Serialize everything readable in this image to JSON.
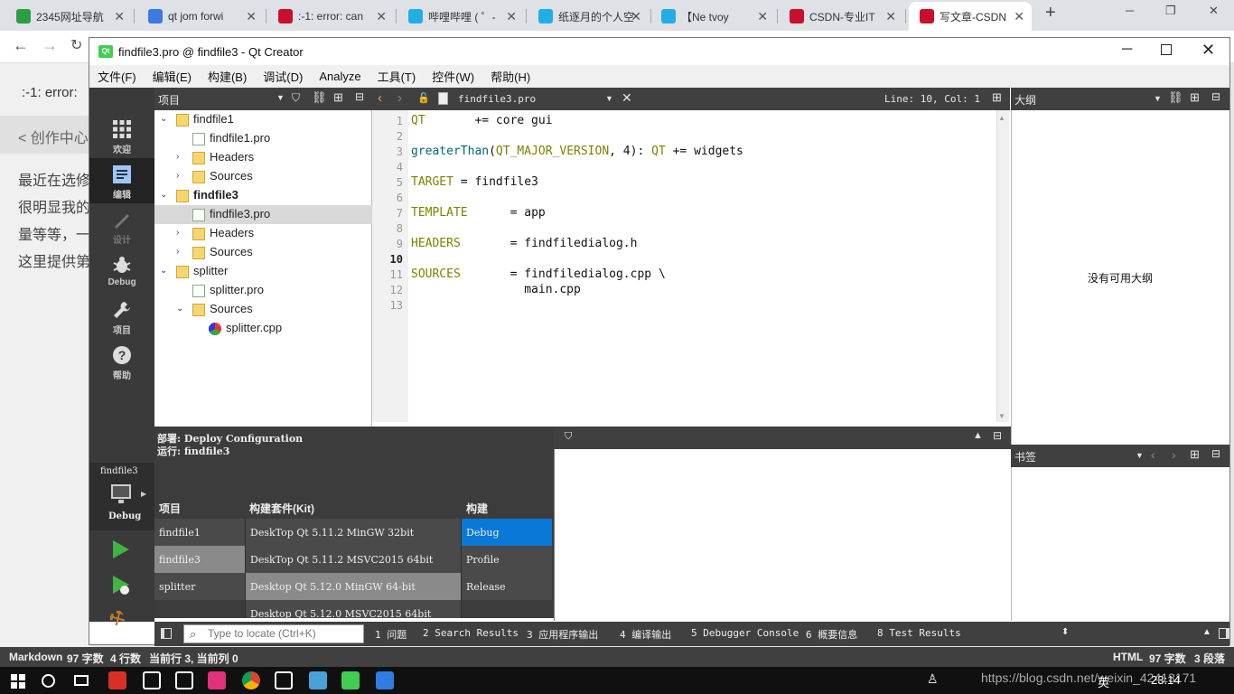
{
  "browser": {
    "tabs": [
      {
        "label": "2345网址导航",
        "color": "#2a9d45"
      },
      {
        "label": "qt jom forwi",
        "color": "#3b7ae0"
      },
      {
        "label": ":-1: error: can",
        "color": "#c8102e"
      },
      {
        "label": "哔哩哔哩 ( ゜-",
        "color": "#23ade5"
      },
      {
        "label": "纸逐月的个人空",
        "color": "#23ade5"
      },
      {
        "label": "【Ne tvoy",
        "color": "#23ade5"
      },
      {
        "label": "CSDN-专业IT",
        "color": "#c8102e"
      },
      {
        "label": "写文章-CSDN",
        "color": "#c8102e"
      }
    ],
    "new_tab": "+",
    "address_partial": ":-1: error:"
  },
  "csdn": {
    "back_label": "< 创作中心",
    "lines": [
      "最近在选修",
      "很明显我的",
      "量等等，一",
      "这里提供第"
    ]
  },
  "qt": {
    "title": "findfile3.pro @ findfile3 - Qt Creator",
    "menu": [
      "文件(F)",
      "编辑(E)",
      "构建(B)",
      "调试(D)",
      "Analyze",
      "工具(T)",
      "控件(W)",
      "帮助(H)"
    ],
    "modes": [
      {
        "label": "欢迎",
        "icon": "grid-icon"
      },
      {
        "label": "编辑",
        "icon": "edit-icon"
      },
      {
        "label": "设计",
        "icon": "design-icon"
      },
      {
        "label": "Debug",
        "icon": "bug-icon"
      },
      {
        "label": "项目",
        "icon": "wrench-icon"
      },
      {
        "label": "帮助",
        "icon": "help-icon"
      }
    ],
    "target": {
      "project": "findfile3",
      "config": "Debug"
    },
    "project_panel": {
      "title": "项目",
      "tree": [
        {
          "label": "findfile1",
          "depth": 0,
          "expanded": true,
          "kind": "project",
          "bold": false
        },
        {
          "label": "findfile1.pro",
          "depth": 1,
          "kind": "pro"
        },
        {
          "label": "Headers",
          "depth": 1,
          "expanded": false,
          "kind": "headers"
        },
        {
          "label": "Sources",
          "depth": 1,
          "expanded": false,
          "kind": "sources"
        },
        {
          "label": "findfile3",
          "depth": 0,
          "expanded": true,
          "kind": "project",
          "bold": true
        },
        {
          "label": "findfile3.pro",
          "depth": 1,
          "kind": "pro",
          "selected": true
        },
        {
          "label": "Headers",
          "depth": 1,
          "expanded": false,
          "kind": "headers"
        },
        {
          "label": "Sources",
          "depth": 1,
          "expanded": false,
          "kind": "sources"
        },
        {
          "label": "splitter",
          "depth": 0,
          "expanded": true,
          "kind": "project",
          "bold": false
        },
        {
          "label": "splitter.pro",
          "depth": 1,
          "kind": "pro"
        },
        {
          "label": "Sources",
          "depth": 1,
          "expanded": true,
          "kind": "sources"
        },
        {
          "label": "splitter.cpp",
          "depth": 2,
          "kind": "cpp"
        }
      ]
    },
    "editor": {
      "file": "findfile3.pro",
      "position": "Line: 10, Col: 1",
      "lines": [
        {
          "n": "1",
          "parts": [
            [
              "kw",
              "QT"
            ],
            [
              "",
              "       += core gui"
            ]
          ]
        },
        {
          "n": "2",
          "parts": []
        },
        {
          "n": "3",
          "parts": [
            [
              "fn",
              "greaterThan"
            ],
            [
              "",
              "("
            ],
            [
              "kw",
              "QT_MAJOR_VERSION"
            ],
            [
              "",
              ", 4): "
            ],
            [
              "kw",
              "QT"
            ],
            [
              "",
              " += widgets"
            ]
          ]
        },
        {
          "n": "4",
          "parts": []
        },
        {
          "n": "5",
          "parts": [
            [
              "kw",
              "TARGET"
            ],
            [
              "",
              " = findfile3"
            ]
          ]
        },
        {
          "n": "6",
          "parts": []
        },
        {
          "n": "7",
          "parts": [
            [
              "kw",
              "TEMPLATE"
            ],
            [
              "",
              "      = app"
            ]
          ]
        },
        {
          "n": "8",
          "parts": []
        },
        {
          "n": "9",
          "parts": [
            [
              "kw",
              "HEADERS"
            ],
            [
              "",
              "       = findfiledialog.h"
            ]
          ]
        },
        {
          "n": "10",
          "parts": [],
          "current": true
        },
        {
          "n": "11",
          "parts": [
            [
              "kw",
              "SOURCES"
            ],
            [
              "",
              "       = findfiledialog.cpp \\"
            ]
          ]
        },
        {
          "n": "12",
          "parts": [
            [
              "",
              "                main.cpp"
            ]
          ]
        },
        {
          "n": "13",
          "parts": []
        }
      ]
    },
    "outline": {
      "title": "大纲",
      "empty_text": "没有可用大纲"
    },
    "bookmarks": {
      "title": "书签"
    },
    "kit_popup": {
      "deploy_label": "部署:",
      "deploy_value": "Deploy Configuration",
      "run_label": "运行:",
      "run_value": "findfile3",
      "headers": [
        "项目",
        "构建套件(Kit)",
        "构建"
      ],
      "projects": [
        "findfile1",
        "findfile3",
        "splitter"
      ],
      "selected_project": 1,
      "kits": [
        "DeskTop Qt 5.11.2 MinGW 32bit",
        "DeskTop Qt 5.11.2 MSVC2015 64bit",
        "Desktop Qt 5.12.0 MinGW 64-bit",
        "Desktop Qt 5.12.0 MSVC2015 64bit"
      ],
      "selected_kit": 2,
      "builds": [
        "Debug",
        "Profile",
        "Release"
      ],
      "selected_build": 0
    },
    "locator_placeholder": "Type to locate (Ctrl+K)",
    "output_tabs": [
      "1 问题",
      "2 Search Results",
      "3 应用程序输出",
      "4 编译输出",
      "5 Debugger Console",
      "6 概要信息",
      "8 Test Results"
    ]
  },
  "markdown_status": {
    "left": [
      "Markdown",
      "97 字数",
      "4 行数",
      "当前行 3, 当前列 0"
    ],
    "right": [
      "HTML",
      "97 字数",
      "3 段落"
    ]
  },
  "taskbar": {
    "tray_url": "https://blog.csdn.net/weixin_42413171",
    "ime": "英",
    "time": "23:14"
  },
  "colors": {
    "qt_green": "#41cd52",
    "kit_select_blue": "#0a78d7",
    "dark_panel": "#404040"
  }
}
